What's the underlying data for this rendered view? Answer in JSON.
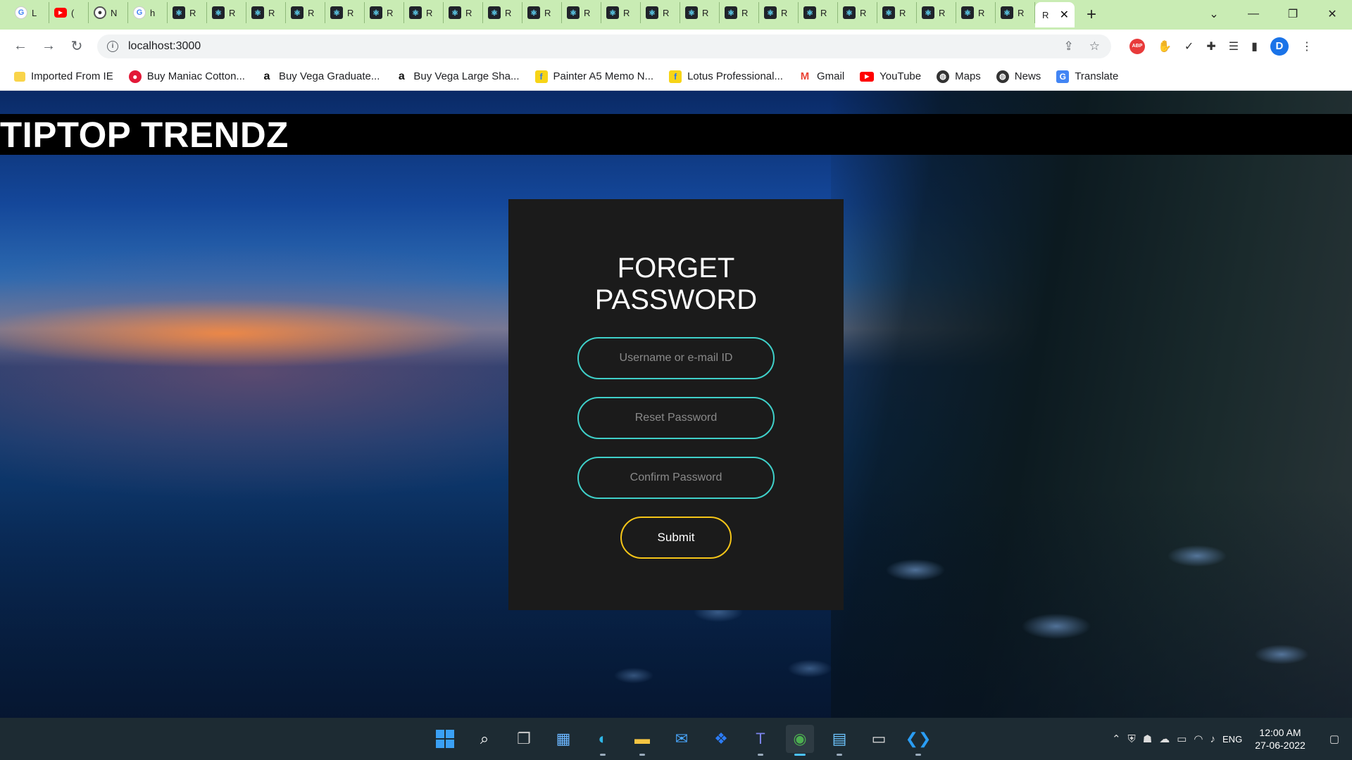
{
  "browser": {
    "tabs": [
      {
        "icon": "google-icon",
        "label": "L"
      },
      {
        "icon": "youtube-icon",
        "label": "("
      },
      {
        "icon": "github-icon",
        "label": "N"
      },
      {
        "icon": "google-icon",
        "label": "h"
      },
      {
        "icon": "react-icon",
        "label": "R"
      },
      {
        "icon": "react-icon",
        "label": "R"
      },
      {
        "icon": "react-icon",
        "label": "R"
      },
      {
        "icon": "react-icon",
        "label": "R"
      },
      {
        "icon": "react-icon",
        "label": "R"
      },
      {
        "icon": "react-icon",
        "label": "R"
      },
      {
        "icon": "react-icon",
        "label": "R"
      },
      {
        "icon": "react-icon",
        "label": "R"
      },
      {
        "icon": "react-icon",
        "label": "R"
      },
      {
        "icon": "react-icon",
        "label": "R"
      },
      {
        "icon": "react-icon",
        "label": "R"
      },
      {
        "icon": "react-icon",
        "label": "R"
      },
      {
        "icon": "react-icon",
        "label": "R"
      },
      {
        "icon": "react-icon",
        "label": "R"
      },
      {
        "icon": "react-icon",
        "label": "R"
      },
      {
        "icon": "react-icon",
        "label": "R"
      },
      {
        "icon": "react-icon",
        "label": "R"
      },
      {
        "icon": "react-icon",
        "label": "R"
      },
      {
        "icon": "react-icon",
        "label": "R"
      },
      {
        "icon": "react-icon",
        "label": "R"
      },
      {
        "icon": "react-icon",
        "label": "R"
      },
      {
        "icon": "react-icon",
        "label": "R"
      }
    ],
    "active_tab": {
      "label": "R"
    },
    "url": "localhost:3000",
    "bookmarks": [
      {
        "icon": "folder-icon",
        "label": "Imported From IE"
      },
      {
        "icon": "store-icon",
        "label": "Buy Maniac Cotton..."
      },
      {
        "icon": "amazon-icon",
        "label": "Buy Vega Graduate..."
      },
      {
        "icon": "amazon-icon",
        "label": "Buy Vega Large Sha..."
      },
      {
        "icon": "flipkart-icon",
        "label": "Painter A5 Memo N..."
      },
      {
        "icon": "flipkart-icon",
        "label": "Lotus Professional..."
      },
      {
        "icon": "gmail-icon",
        "label": "Gmail"
      },
      {
        "icon": "youtube-icon",
        "label": "YouTube"
      },
      {
        "icon": "globe-icon",
        "label": "Maps"
      },
      {
        "icon": "globe-icon",
        "label": "News"
      },
      {
        "icon": "translate-icon",
        "label": "Translate"
      }
    ],
    "profile_initial": "D",
    "abp_label": "ABP"
  },
  "page": {
    "brand": "TIPTOP TRENDZ",
    "form": {
      "title": "FORGET PASSWORD",
      "username_placeholder": "Username or e-mail ID",
      "reset_placeholder": "Reset Password",
      "confirm_placeholder": "Confirm Password",
      "submit_label": "Submit"
    }
  },
  "taskbar": {
    "language": "ENG",
    "time": "12:00 AM",
    "date": "27-06-2022"
  },
  "colors": {
    "input_border": "#3fd0c9",
    "submit_border": "#f5c518",
    "card_bg": "#1b1b1b"
  }
}
